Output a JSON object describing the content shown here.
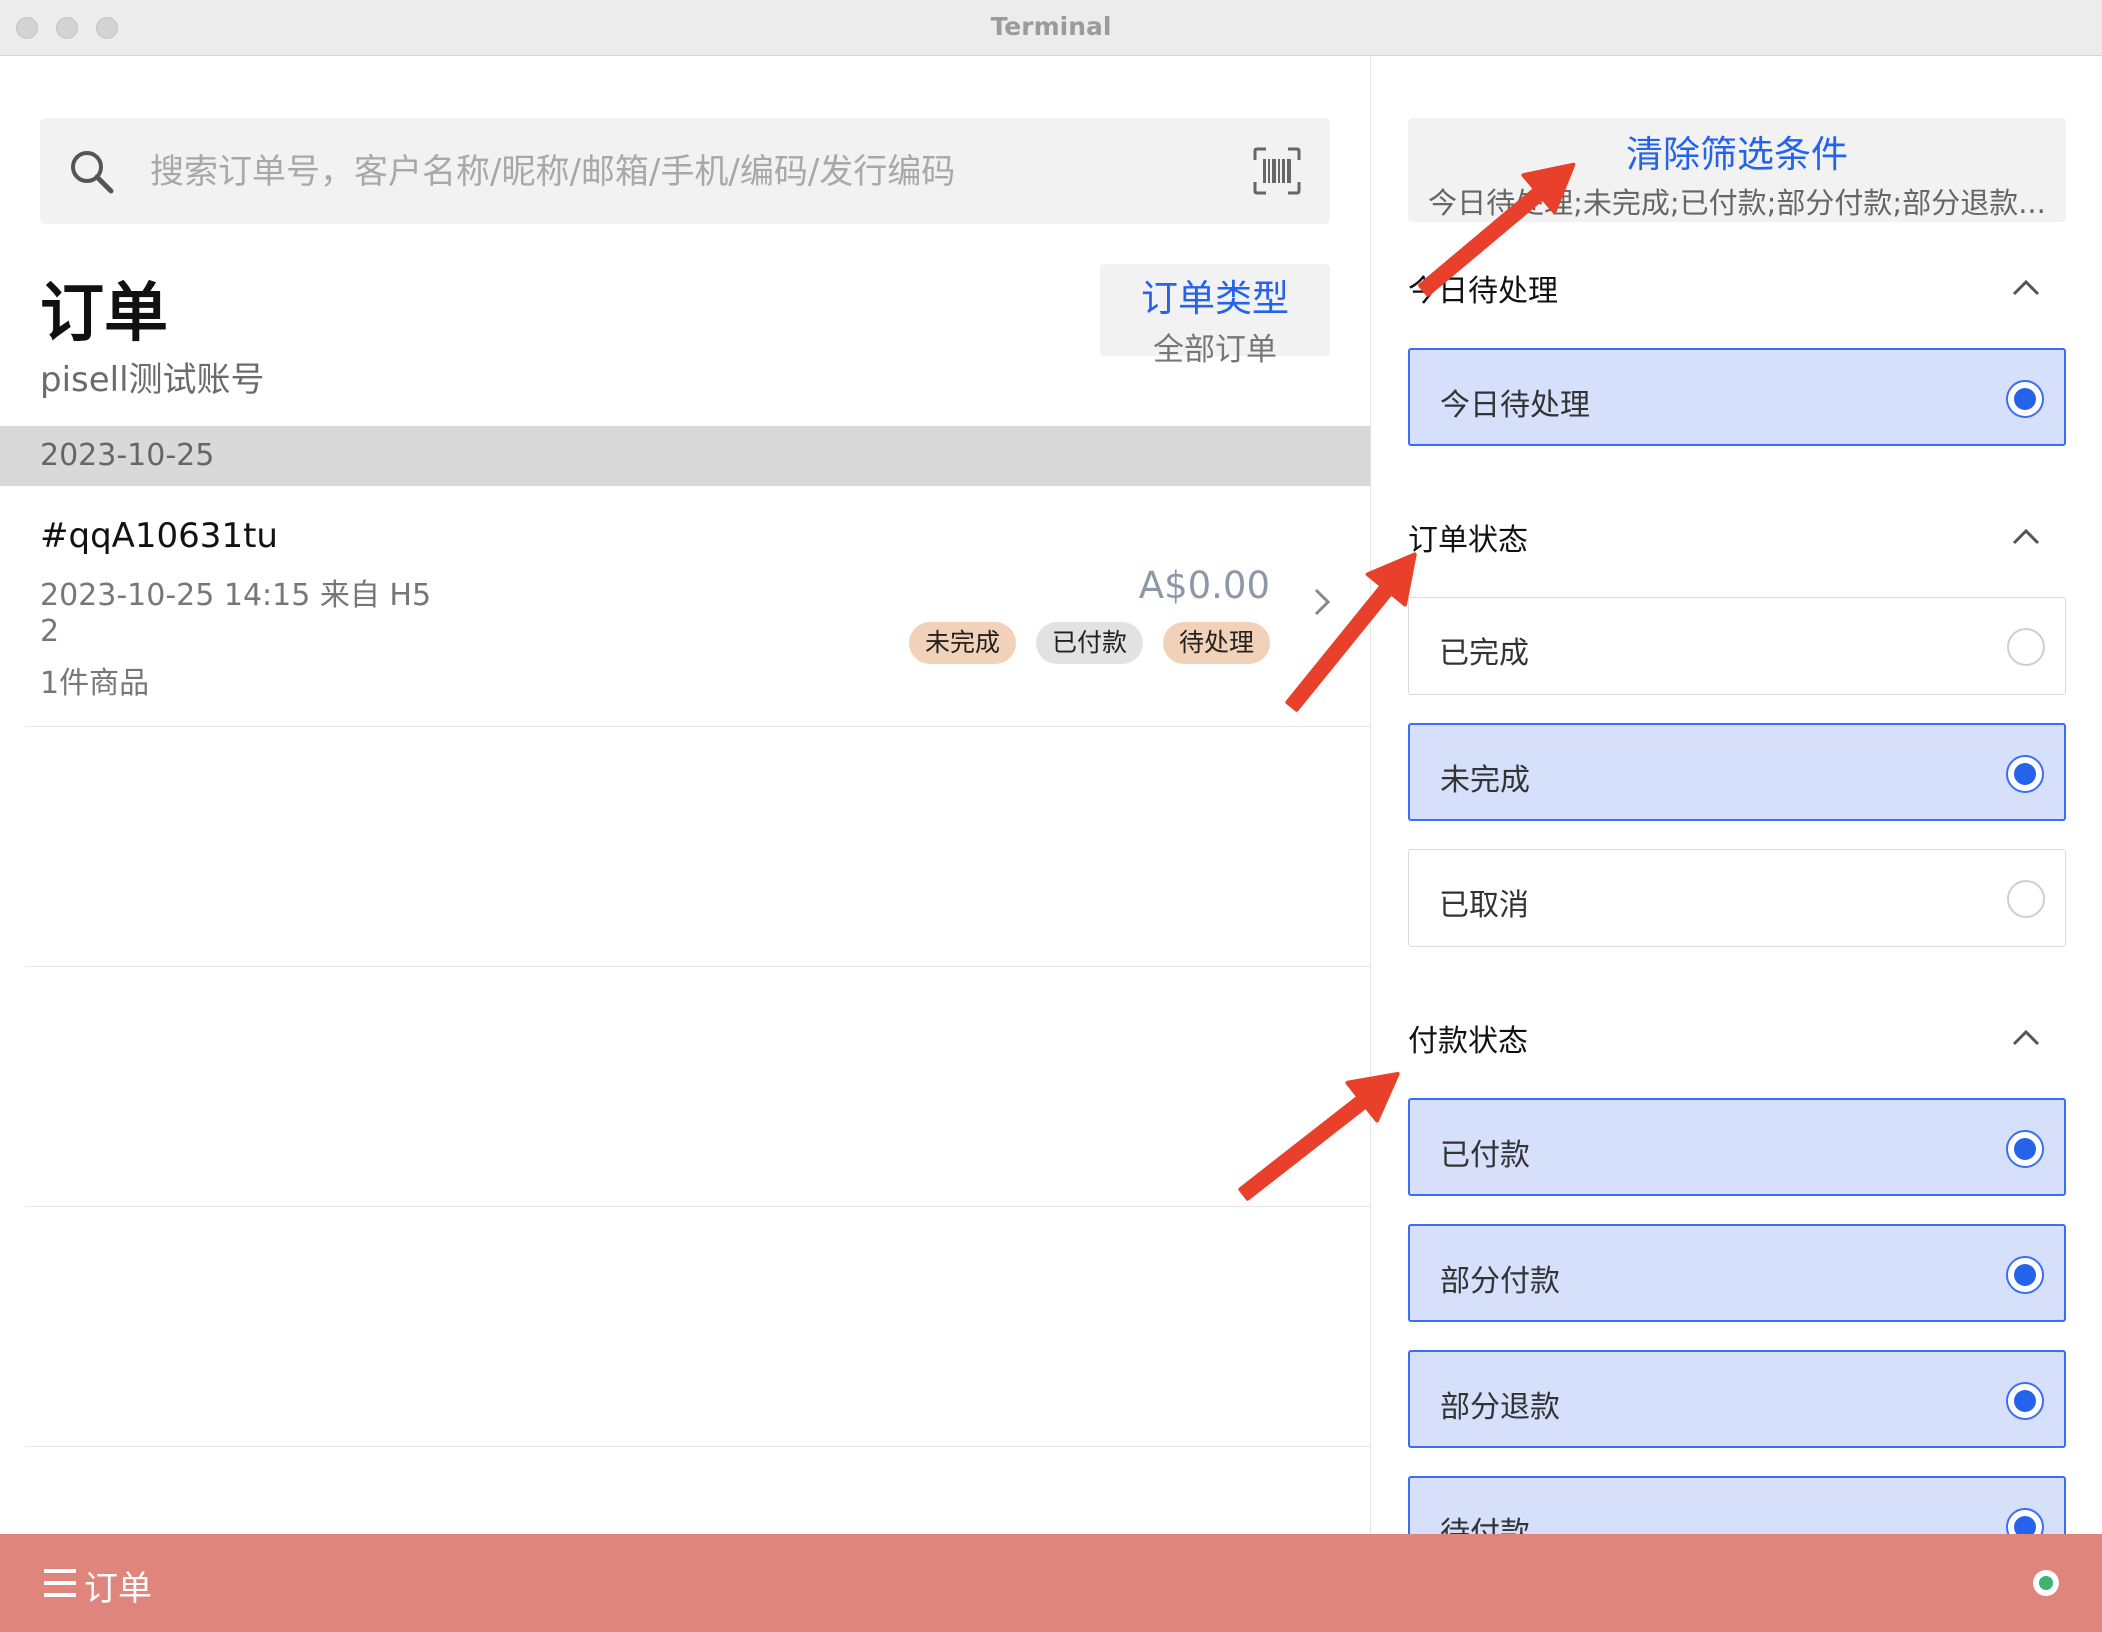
{
  "window": {
    "title": "Terminal"
  },
  "search": {
    "placeholder": "搜索订单号，客户名称/昵称/邮箱/手机/编码/发行编码"
  },
  "header": {
    "title": "订单",
    "account": "pisell测试账号"
  },
  "order_type": {
    "label": "订单类型",
    "value": "全部订单"
  },
  "date_group": "2023-10-25",
  "orders": [
    {
      "id": "#qqA10631tu",
      "time": "2023-10-25 14:15 来自 H5",
      "qty": "2",
      "items": "1件商品",
      "amount": "A$0.00",
      "tags": [
        "未完成",
        "已付款",
        "待处理"
      ]
    }
  ],
  "filters": {
    "clear_label": "清除筛选条件",
    "summary": "今日待处理;未完成;已付款;部分付款;部分退款...",
    "sections": [
      {
        "title": "今日待处理",
        "options": [
          {
            "label": "今日待处理",
            "selected": true
          }
        ]
      },
      {
        "title": "订单状态",
        "options": [
          {
            "label": "已完成",
            "selected": false
          },
          {
            "label": "未完成",
            "selected": true
          },
          {
            "label": "已取消",
            "selected": false
          }
        ]
      },
      {
        "title": "付款状态",
        "options": [
          {
            "label": "已付款",
            "selected": true
          },
          {
            "label": "部分付款",
            "selected": true
          },
          {
            "label": "部分退款",
            "selected": true
          },
          {
            "label": "待付款",
            "selected": true
          }
        ]
      }
    ]
  },
  "bottom_bar": {
    "label": "订单"
  },
  "colors": {
    "accent": "#2563eb",
    "selected_bg": "#d6e0fb",
    "bottom_bar": "#e0857c",
    "arrow": "#e8402b",
    "tag_orange": "#f1d2b8"
  }
}
